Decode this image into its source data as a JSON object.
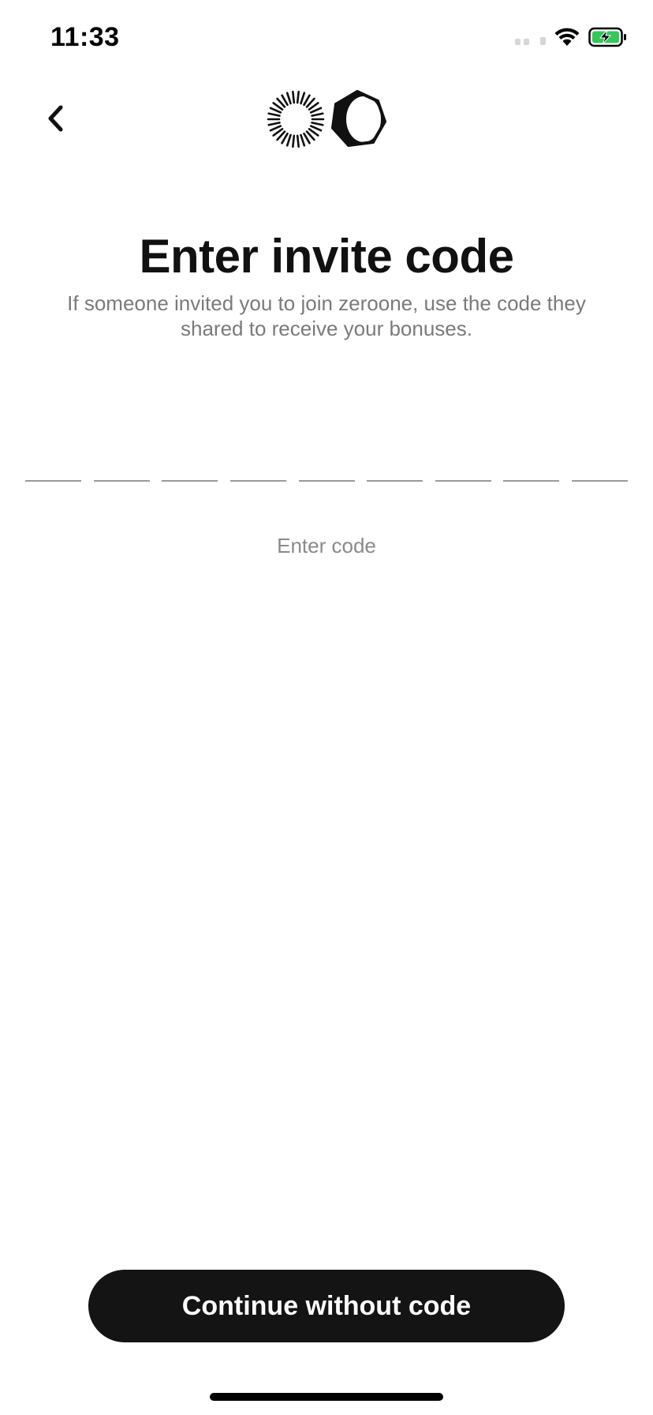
{
  "status_bar": {
    "time": "11:33",
    "battery_color": "#34c759"
  },
  "header": {
    "back_icon": "chevron-left-icon",
    "logo_icons": [
      "sunburst-logo-icon",
      "heptagon-logo-icon"
    ]
  },
  "main": {
    "title": "Enter invite code",
    "subtitle": "If someone invited you to join zeroone, use the code they shared to receive your bonuses.",
    "code_slots": [
      "",
      "",
      "",
      "",
      "",
      "",
      "",
      "",
      ""
    ],
    "hint": "Enter code"
  },
  "footer": {
    "continue_label": "Continue without code"
  },
  "colors": {
    "button_bg": "#141414",
    "hint_text": "#8a8a8a",
    "subtitle_text": "#7a7a7a"
  }
}
